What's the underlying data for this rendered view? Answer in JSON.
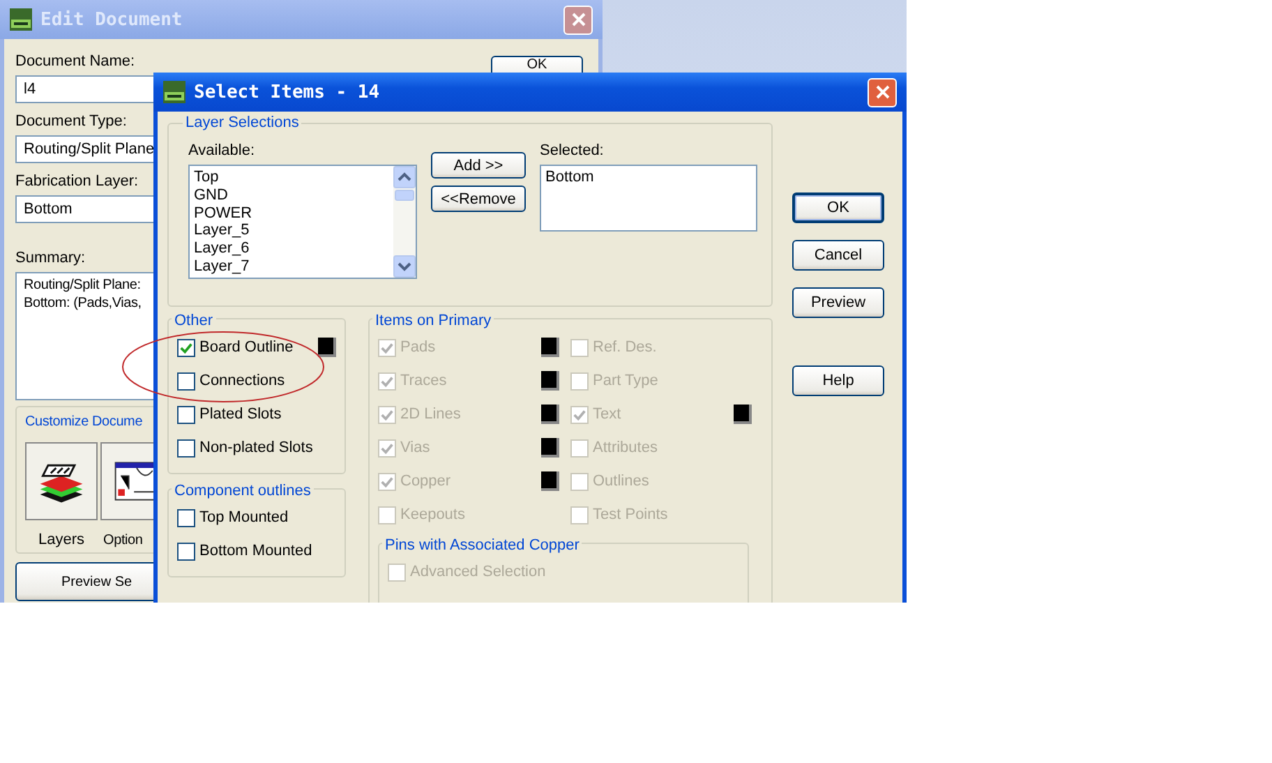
{
  "background_window": {
    "title": "Edit Document",
    "fields": [
      {
        "label": "Document Name:",
        "value": "l4"
      },
      {
        "label": "Document Type:",
        "value": "Routing/Split Plane"
      },
      {
        "label": "Fabrication Layer:",
        "value": "Bottom"
      }
    ],
    "ok_button": "OK",
    "summary": {
      "label": "Summary:",
      "lines": [
        "Routing/Split Plane:",
        "Bottom: (Pads,Vias,"
      ]
    },
    "customize": {
      "title": "Customize Docume",
      "buttons": [
        {
          "kind": "layers",
          "label": "Layers"
        },
        {
          "kind": "options",
          "label": "Option"
        }
      ]
    },
    "preview_button": "Preview Se"
  },
  "dialog": {
    "title": "Select Items - 14",
    "layer_selections": {
      "title": "Layer Selections",
      "available_label": "Available:",
      "available": [
        "Top",
        "GND",
        "POWER",
        "Layer_5",
        "Layer_6",
        "Layer_7"
      ],
      "add_button": "Add >>",
      "remove_button": "<<Remove",
      "selected_label": "Selected:",
      "selected": [
        "Bottom"
      ]
    },
    "buttons": [
      {
        "label": "OK",
        "default": true
      },
      {
        "label": "Cancel",
        "default": false
      },
      {
        "label": "Preview",
        "default": false
      },
      {
        "label": "Help",
        "default": false
      }
    ],
    "other": {
      "title": "Other",
      "items": [
        {
          "label": "Board Outline",
          "checked": true,
          "swatch": true
        },
        {
          "label": "Connections",
          "checked": false,
          "swatch": false
        },
        {
          "label": "Plated Slots",
          "checked": false,
          "swatch": false
        },
        {
          "label": "Non-plated Slots",
          "checked": false,
          "swatch": false
        }
      ]
    },
    "component_outlines": {
      "title": "Component outlines",
      "items": [
        {
          "label": "Top Mounted",
          "checked": false,
          "swatch": false
        },
        {
          "label": "Bottom Mounted",
          "checked": false,
          "swatch": false
        }
      ]
    },
    "items_on_primary": {
      "title": "Items on Primary",
      "disabled": true,
      "left": [
        {
          "label": "Pads",
          "checked": true,
          "swatch": true
        },
        {
          "label": "Traces",
          "checked": true,
          "swatch": true
        },
        {
          "label": "2D Lines",
          "checked": true,
          "swatch": true
        },
        {
          "label": "Vias",
          "checked": true,
          "swatch": true
        },
        {
          "label": "Copper",
          "checked": true,
          "swatch": true
        },
        {
          "label": "Keepouts",
          "checked": false,
          "swatch": false
        }
      ],
      "right": [
        {
          "label": "Ref. Des.",
          "checked": false,
          "swatch": false
        },
        {
          "label": "Part Type",
          "checked": false,
          "swatch": false
        },
        {
          "label": "Text",
          "checked": true,
          "swatch": true
        },
        {
          "label": "Attributes",
          "checked": false,
          "swatch": false
        },
        {
          "label": "Outlines",
          "checked": false,
          "swatch": false
        },
        {
          "label": "Test Points",
          "checked": false,
          "swatch": false
        }
      ],
      "pins": {
        "title": "Pins with Associated Copper",
        "items": [
          {
            "label": "Advanced Selection",
            "checked": false
          }
        ]
      }
    }
  }
}
